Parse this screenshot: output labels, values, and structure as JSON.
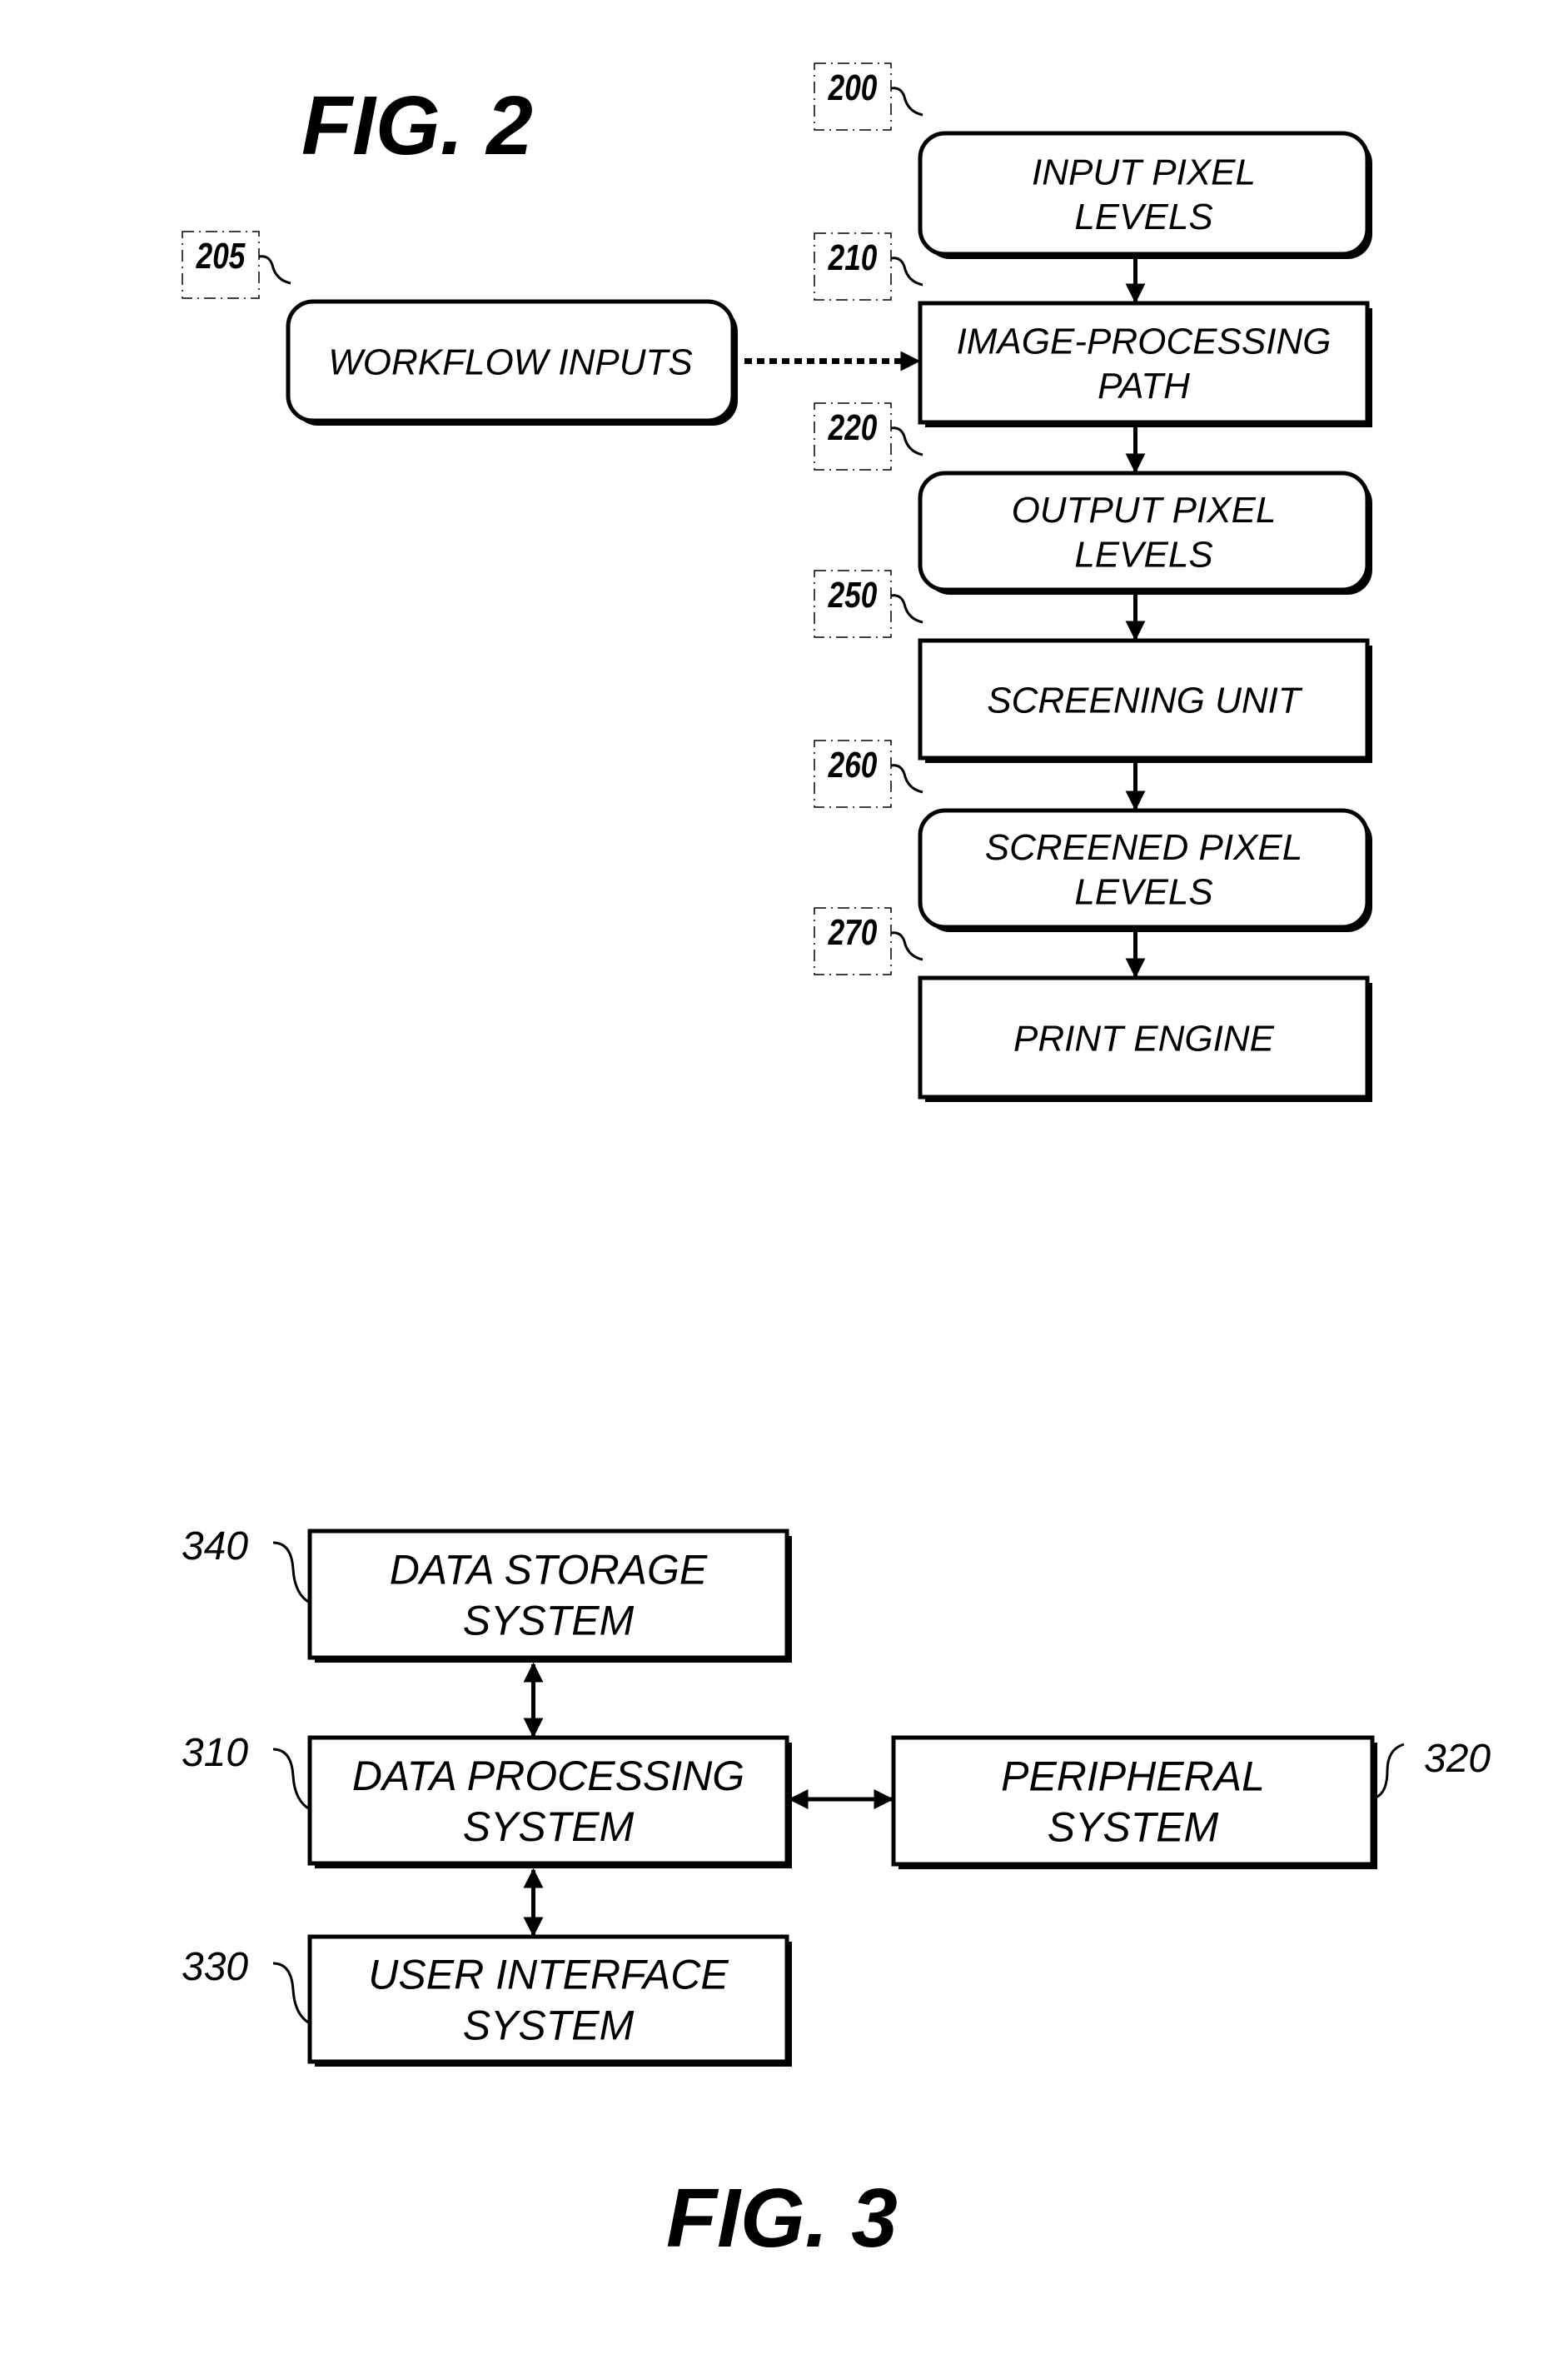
{
  "figure2": {
    "title": "FIG. 2",
    "nodes": [
      {
        "id": "200",
        "ref": "200",
        "lines": [
          "INPUT PIXEL",
          "LEVELS"
        ],
        "shape": "rounded"
      },
      {
        "id": "205",
        "ref": "205",
        "lines": [
          "WORKFLOW INPUTS"
        ],
        "shape": "rounded"
      },
      {
        "id": "210",
        "ref": "210",
        "lines": [
          "IMAGE-PROCESSING",
          "PATH"
        ],
        "shape": "rect"
      },
      {
        "id": "220",
        "ref": "220",
        "lines": [
          "OUTPUT PIXEL",
          "LEVELS"
        ],
        "shape": "rounded"
      },
      {
        "id": "250",
        "ref": "250",
        "lines": [
          "SCREENING UNIT"
        ],
        "shape": "rect"
      },
      {
        "id": "260",
        "ref": "260",
        "lines": [
          "SCREENED PIXEL",
          "LEVELS"
        ],
        "shape": "rounded"
      },
      {
        "id": "270",
        "ref": "270",
        "lines": [
          "PRINT ENGINE"
        ],
        "shape": "rect"
      }
    ],
    "edges": [
      {
        "from": "200",
        "to": "210",
        "style": "solid",
        "direction": "forward"
      },
      {
        "from": "205",
        "to": "210",
        "style": "dotted",
        "direction": "forward"
      },
      {
        "from": "210",
        "to": "220",
        "style": "solid",
        "direction": "forward"
      },
      {
        "from": "220",
        "to": "250",
        "style": "solid",
        "direction": "forward"
      },
      {
        "from": "250",
        "to": "260",
        "style": "solid",
        "direction": "forward"
      },
      {
        "from": "260",
        "to": "270",
        "style": "solid",
        "direction": "forward"
      }
    ]
  },
  "figure3": {
    "title": "FIG. 3",
    "nodes": [
      {
        "id": "340",
        "ref": "340",
        "lines": [
          "DATA STORAGE",
          "SYSTEM"
        ],
        "shape": "rect"
      },
      {
        "id": "310",
        "ref": "310",
        "lines": [
          "DATA PROCESSING",
          "SYSTEM"
        ],
        "shape": "rect"
      },
      {
        "id": "320",
        "ref": "320",
        "lines": [
          "PERIPHERAL",
          "SYSTEM"
        ],
        "shape": "rect"
      },
      {
        "id": "330",
        "ref": "330",
        "lines": [
          "USER INTERFACE",
          "SYSTEM"
        ],
        "shape": "rect"
      }
    ],
    "edges": [
      {
        "from": "340",
        "to": "310",
        "style": "solid",
        "direction": "both"
      },
      {
        "from": "310",
        "to": "320",
        "style": "solid",
        "direction": "both"
      },
      {
        "from": "310",
        "to": "330",
        "style": "solid",
        "direction": "both"
      }
    ]
  }
}
